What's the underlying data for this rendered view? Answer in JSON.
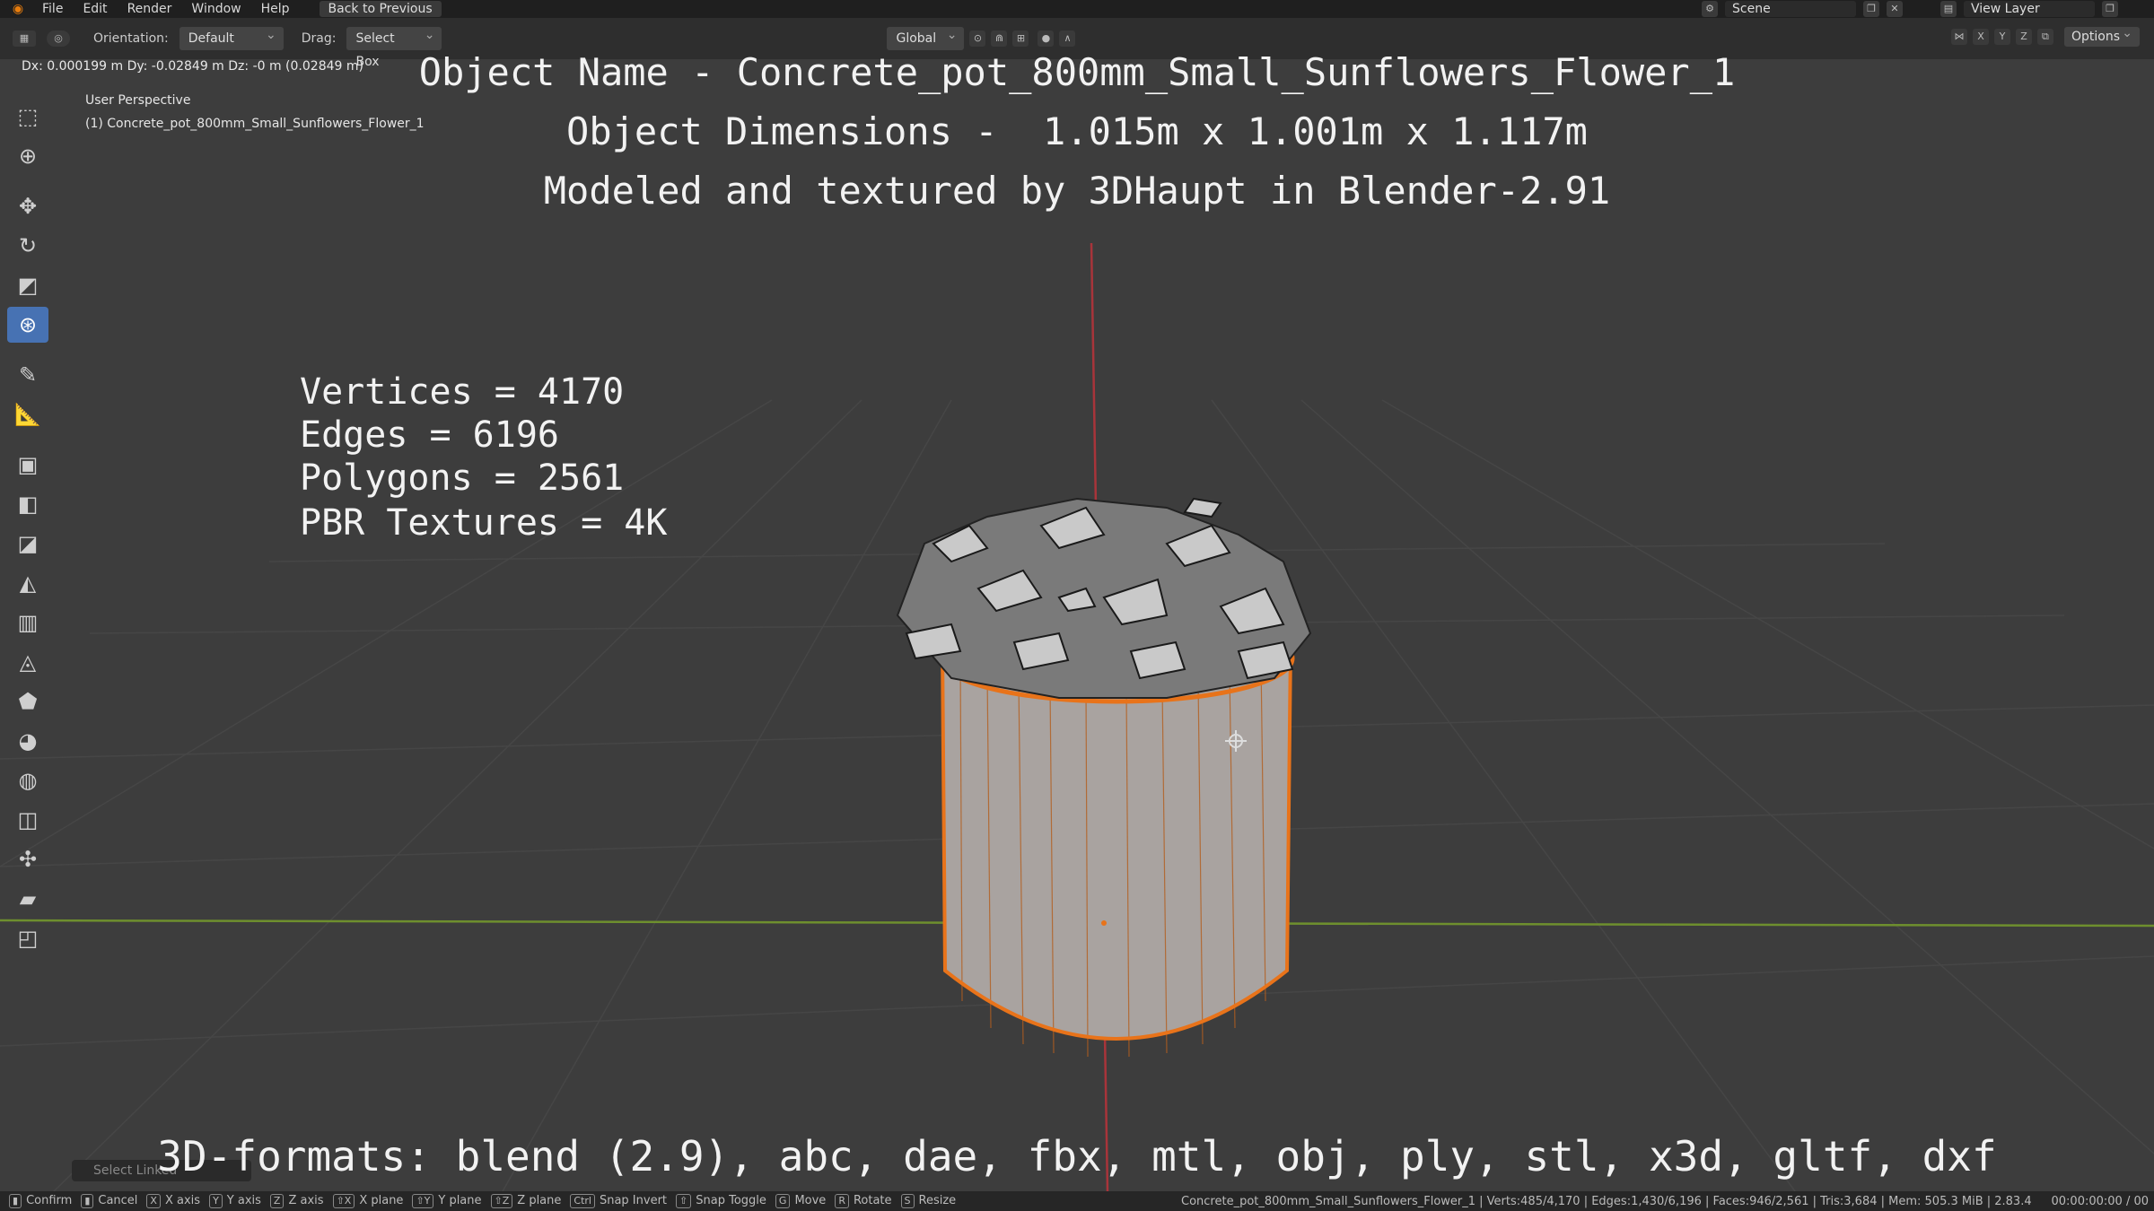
{
  "menu": {
    "items": [
      "File",
      "Edit",
      "Render",
      "Window",
      "Help"
    ],
    "back_button": "Back to Previous",
    "scene": "Scene",
    "view_layer": "View Layer"
  },
  "header": {
    "orientation_label": "Orientation:",
    "orientation_value": "Default",
    "drag_label": "Drag:",
    "drag_value": "Select Box",
    "transform_orientation": "Global",
    "axes": [
      "X",
      "Y",
      "Z"
    ],
    "options": "Options"
  },
  "viewport": {
    "delta_readout": "Dx: 0.000199 m  Dy: -0.02849 m  Dz: -0 m (0.02849 m)",
    "perspective": "User Perspective",
    "object_label": "(1) Concrete_pot_800mm_Small_Sunflowers_Flower_1"
  },
  "overlay": {
    "object_name": "Object Name - Concrete_pot_800mm_Small_Sunflowers_Flower_1",
    "object_dimensions": "Object Dimensions -  1.015m x 1.001m x 1.117m",
    "credit": "Modeled and textured by 3DHaupt in Blender-2.91",
    "vertices": "Vertices = 4170",
    "edges": "Edges = 6196",
    "polygons": "Polygons = 2561",
    "textures": "PBR Textures = 4K",
    "formats": "3D-formats: blend (2.9), abc, dae, fbx, mtl, obj, ply, stl, x3d, gltf, dxf"
  },
  "panel": {
    "select_linked": "Select Linked"
  },
  "statusbar": {
    "hints": [
      {
        "key": "",
        "label": "Confirm"
      },
      {
        "key": "",
        "label": "Cancel"
      },
      {
        "key": "X",
        "label": "X axis"
      },
      {
        "key": "Y",
        "label": "Y axis"
      },
      {
        "key": "Z",
        "label": "Z axis"
      },
      {
        "key": "⇧X",
        "label": "X plane"
      },
      {
        "key": "⇧Y",
        "label": "Y plane"
      },
      {
        "key": "⇧Z",
        "label": "Z plane"
      },
      {
        "key": "Ctrl",
        "label": "Snap Invert"
      },
      {
        "key": "⇧",
        "label": "Snap Toggle"
      },
      {
        "key": "G",
        "label": "Move"
      },
      {
        "key": "R",
        "label": "Rotate"
      },
      {
        "key": "S",
        "label": "Resize"
      }
    ],
    "stats": "Concrete_pot_800mm_Small_Sunflowers_Flower_1 | Verts:485/4,170 | Edges:1,430/6,196 | Faces:946/2,561 | Tris:3,684 | Mem: 505.3 MiB | 2.83.4",
    "time": "00:00:00:00 / 00"
  },
  "colors": {
    "accent_blue": "#4772b3",
    "selection_orange": "#e8731a",
    "x_axis_red": "#a8343a",
    "y_axis_green": "#6e8f2e"
  }
}
